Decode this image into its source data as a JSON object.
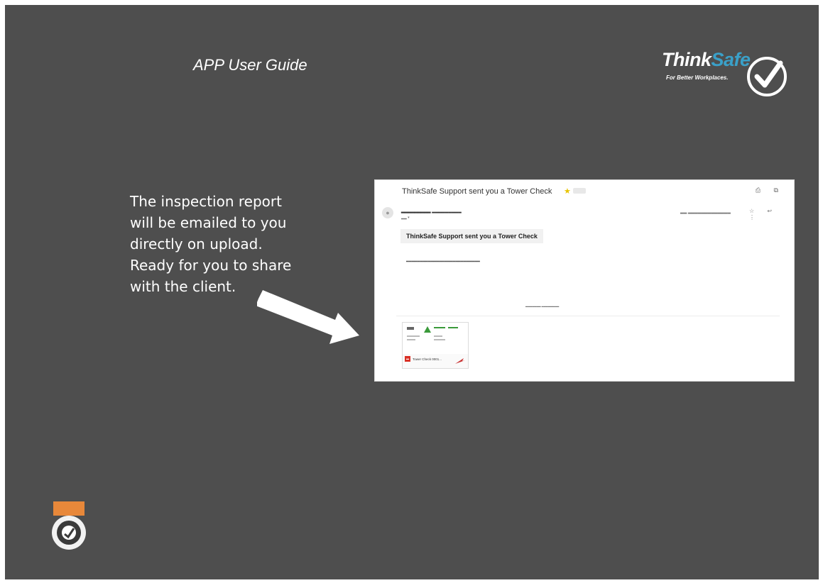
{
  "header": {
    "title": "APP User Guide"
  },
  "logo": {
    "word_think": "Think",
    "word_safe": "Safe",
    "tagline": "For Better Workplaces."
  },
  "instructions": {
    "lines": [
      "The inspection report",
      "will be emailed to you",
      "directly on upload.",
      "Ready for you to share",
      "with the client."
    ]
  },
  "email": {
    "subject": "ThinkSafe Support sent you a Tower Check",
    "heading": "ThinkSafe Support sent you a Tower Check",
    "attachment_name": "Tower Check 0001..."
  },
  "colors": {
    "slide_bg": "#4e4e4e",
    "logo_accent": "#3aa0c8",
    "badge_orange": "#e8883a"
  },
  "icons": [
    "checkmark-logo-icon",
    "arrow-icon",
    "star-icon",
    "pdf-icon",
    "certification-badge-icon"
  ]
}
